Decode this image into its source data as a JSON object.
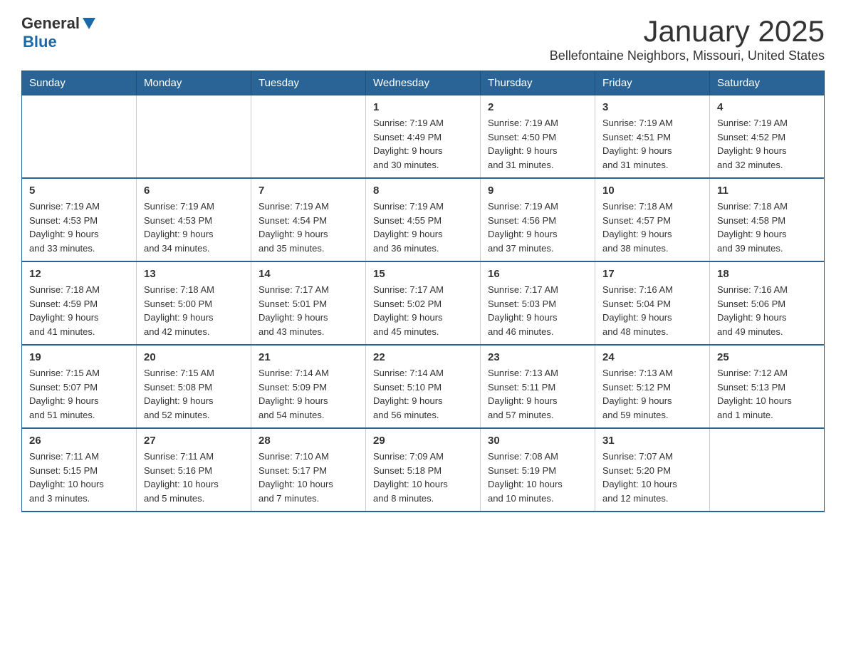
{
  "header": {
    "logo": {
      "general": "General",
      "triangle": "",
      "blue": "Blue"
    },
    "title": "January 2025",
    "subtitle": "Bellefontaine Neighbors, Missouri, United States"
  },
  "calendar": {
    "days_of_week": [
      "Sunday",
      "Monday",
      "Tuesday",
      "Wednesday",
      "Thursday",
      "Friday",
      "Saturday"
    ],
    "weeks": [
      {
        "cells": [
          {
            "day": "",
            "info": ""
          },
          {
            "day": "",
            "info": ""
          },
          {
            "day": "",
            "info": ""
          },
          {
            "day": "1",
            "info": "Sunrise: 7:19 AM\nSunset: 4:49 PM\nDaylight: 9 hours\nand 30 minutes."
          },
          {
            "day": "2",
            "info": "Sunrise: 7:19 AM\nSunset: 4:50 PM\nDaylight: 9 hours\nand 31 minutes."
          },
          {
            "day": "3",
            "info": "Sunrise: 7:19 AM\nSunset: 4:51 PM\nDaylight: 9 hours\nand 31 minutes."
          },
          {
            "day": "4",
            "info": "Sunrise: 7:19 AM\nSunset: 4:52 PM\nDaylight: 9 hours\nand 32 minutes."
          }
        ]
      },
      {
        "cells": [
          {
            "day": "5",
            "info": "Sunrise: 7:19 AM\nSunset: 4:53 PM\nDaylight: 9 hours\nand 33 minutes."
          },
          {
            "day": "6",
            "info": "Sunrise: 7:19 AM\nSunset: 4:53 PM\nDaylight: 9 hours\nand 34 minutes."
          },
          {
            "day": "7",
            "info": "Sunrise: 7:19 AM\nSunset: 4:54 PM\nDaylight: 9 hours\nand 35 minutes."
          },
          {
            "day": "8",
            "info": "Sunrise: 7:19 AM\nSunset: 4:55 PM\nDaylight: 9 hours\nand 36 minutes."
          },
          {
            "day": "9",
            "info": "Sunrise: 7:19 AM\nSunset: 4:56 PM\nDaylight: 9 hours\nand 37 minutes."
          },
          {
            "day": "10",
            "info": "Sunrise: 7:18 AM\nSunset: 4:57 PM\nDaylight: 9 hours\nand 38 minutes."
          },
          {
            "day": "11",
            "info": "Sunrise: 7:18 AM\nSunset: 4:58 PM\nDaylight: 9 hours\nand 39 minutes."
          }
        ]
      },
      {
        "cells": [
          {
            "day": "12",
            "info": "Sunrise: 7:18 AM\nSunset: 4:59 PM\nDaylight: 9 hours\nand 41 minutes."
          },
          {
            "day": "13",
            "info": "Sunrise: 7:18 AM\nSunset: 5:00 PM\nDaylight: 9 hours\nand 42 minutes."
          },
          {
            "day": "14",
            "info": "Sunrise: 7:17 AM\nSunset: 5:01 PM\nDaylight: 9 hours\nand 43 minutes."
          },
          {
            "day": "15",
            "info": "Sunrise: 7:17 AM\nSunset: 5:02 PM\nDaylight: 9 hours\nand 45 minutes."
          },
          {
            "day": "16",
            "info": "Sunrise: 7:17 AM\nSunset: 5:03 PM\nDaylight: 9 hours\nand 46 minutes."
          },
          {
            "day": "17",
            "info": "Sunrise: 7:16 AM\nSunset: 5:04 PM\nDaylight: 9 hours\nand 48 minutes."
          },
          {
            "day": "18",
            "info": "Sunrise: 7:16 AM\nSunset: 5:06 PM\nDaylight: 9 hours\nand 49 minutes."
          }
        ]
      },
      {
        "cells": [
          {
            "day": "19",
            "info": "Sunrise: 7:15 AM\nSunset: 5:07 PM\nDaylight: 9 hours\nand 51 minutes."
          },
          {
            "day": "20",
            "info": "Sunrise: 7:15 AM\nSunset: 5:08 PM\nDaylight: 9 hours\nand 52 minutes."
          },
          {
            "day": "21",
            "info": "Sunrise: 7:14 AM\nSunset: 5:09 PM\nDaylight: 9 hours\nand 54 minutes."
          },
          {
            "day": "22",
            "info": "Sunrise: 7:14 AM\nSunset: 5:10 PM\nDaylight: 9 hours\nand 56 minutes."
          },
          {
            "day": "23",
            "info": "Sunrise: 7:13 AM\nSunset: 5:11 PM\nDaylight: 9 hours\nand 57 minutes."
          },
          {
            "day": "24",
            "info": "Sunrise: 7:13 AM\nSunset: 5:12 PM\nDaylight: 9 hours\nand 59 minutes."
          },
          {
            "day": "25",
            "info": "Sunrise: 7:12 AM\nSunset: 5:13 PM\nDaylight: 10 hours\nand 1 minute."
          }
        ]
      },
      {
        "cells": [
          {
            "day": "26",
            "info": "Sunrise: 7:11 AM\nSunset: 5:15 PM\nDaylight: 10 hours\nand 3 minutes."
          },
          {
            "day": "27",
            "info": "Sunrise: 7:11 AM\nSunset: 5:16 PM\nDaylight: 10 hours\nand 5 minutes."
          },
          {
            "day": "28",
            "info": "Sunrise: 7:10 AM\nSunset: 5:17 PM\nDaylight: 10 hours\nand 7 minutes."
          },
          {
            "day": "29",
            "info": "Sunrise: 7:09 AM\nSunset: 5:18 PM\nDaylight: 10 hours\nand 8 minutes."
          },
          {
            "day": "30",
            "info": "Sunrise: 7:08 AM\nSunset: 5:19 PM\nDaylight: 10 hours\nand 10 minutes."
          },
          {
            "day": "31",
            "info": "Sunrise: 7:07 AM\nSunset: 5:20 PM\nDaylight: 10 hours\nand 12 minutes."
          },
          {
            "day": "",
            "info": ""
          }
        ]
      }
    ]
  }
}
